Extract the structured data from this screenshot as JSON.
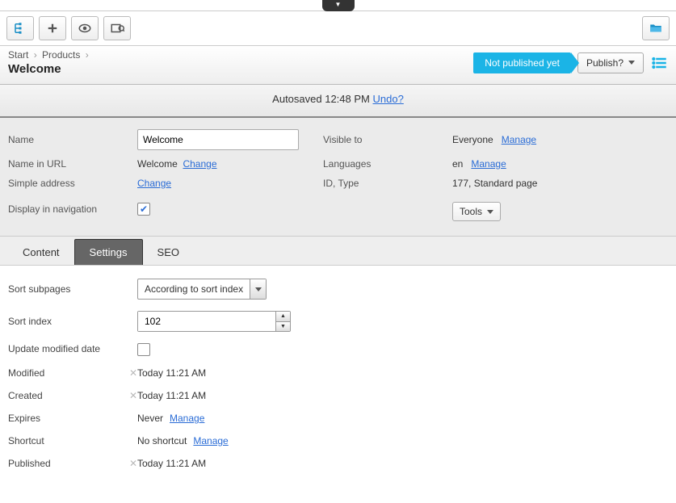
{
  "top_handle_glyph": "▼",
  "breadcrumb": {
    "items": [
      "Start",
      "Products"
    ]
  },
  "page_title": "Welcome",
  "status": "Not published yet",
  "publish_button": "Publish?",
  "autosave": {
    "text": "Autosaved 12:48 PM",
    "undo": "Undo?"
  },
  "meta": {
    "labels": {
      "name": "Name",
      "name_in_url": "Name in URL",
      "simple_address": "Simple address",
      "display_nav": "Display in navigation",
      "visible_to": "Visible to",
      "languages": "Languages",
      "id_type": "ID, Type"
    },
    "name_value": "Welcome",
    "url_value": "Welcome",
    "change": "Change",
    "visible_to_value": "Everyone",
    "manage": "Manage",
    "languages_value": "en",
    "id_type_value": "177, Standard page",
    "tools": "Tools"
  },
  "tabs": {
    "content": "Content",
    "settings": "Settings",
    "seo": "SEO"
  },
  "settings": {
    "labels": {
      "sort_subpages": "Sort subpages",
      "sort_index": "Sort index",
      "update_modified": "Update modified date",
      "modified": "Modified",
      "created": "Created",
      "expires": "Expires",
      "shortcut": "Shortcut",
      "published": "Published"
    },
    "sort_subpages_value": "According to sort index",
    "sort_index_value": "102",
    "modified_value": "Today 11:21 AM",
    "created_value": "Today 11:21 AM",
    "expires_value": "Never",
    "shortcut_value": "No shortcut",
    "published_value": "Today 11:21 AM",
    "manage": "Manage"
  }
}
